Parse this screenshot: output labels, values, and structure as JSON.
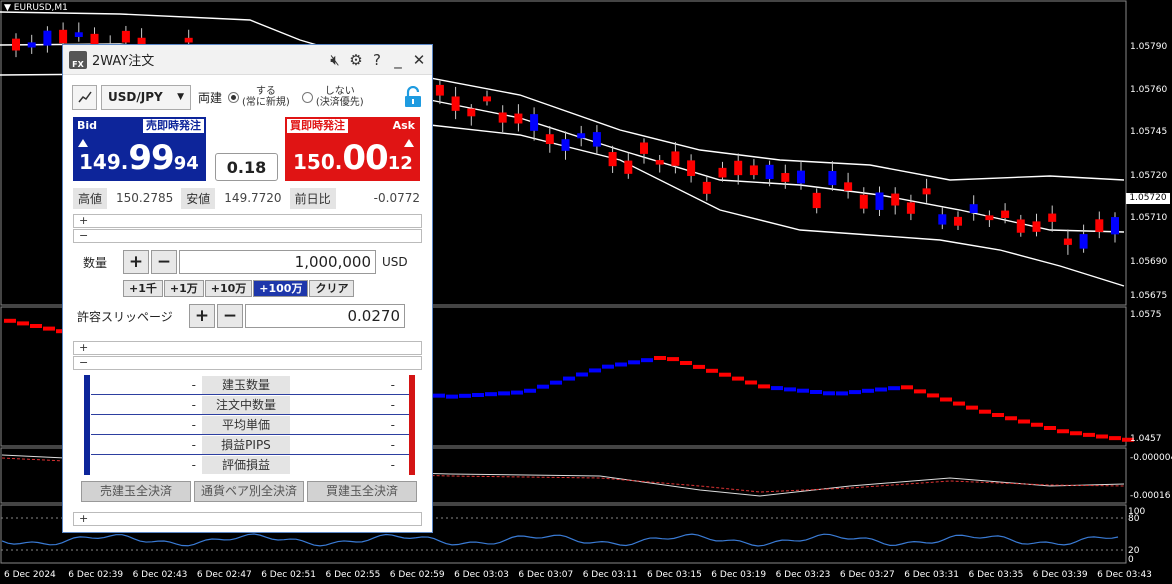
{
  "chart": {
    "symbol": "EURUSD,M1",
    "current_price_tag": "1.05720",
    "main_price_labels": [
      "1.05790",
      "1.05760",
      "1.05745",
      "1.05720",
      "1.05710",
      "1.05690",
      "1.05675"
    ],
    "osc1_labels": [
      "1.0575",
      "1.0457"
    ],
    "osc2_labels": [
      "-0.000004",
      "-0.00016"
    ],
    "osc3_labels": [
      "100",
      "80",
      "20",
      "0"
    ],
    "time_labels": [
      "6 Dec 2024",
      "6 Dec 02:39",
      "6 Dec 02:43",
      "6 Dec 02:47",
      "6 Dec 02:51",
      "6 Dec 02:55",
      "6 Dec 02:59",
      "6 Dec 03:03",
      "6 Dec 03:07",
      "6 Dec 03:11",
      "6 Dec 03:15",
      "6 Dec 03:19",
      "6 Dec 03:23",
      "6 Dec 03:27",
      "6 Dec 03:31",
      "6 Dec 03:35",
      "6 Dec 03:39",
      "6 Dec 03:43"
    ],
    "colors": {
      "bull": "#0000ff",
      "bear": "#ff0000",
      "band": "#ffffff",
      "oscillator": "#3a7bd5"
    }
  },
  "dialog": {
    "title": "2WAY注文",
    "icons": [
      "fx-logo-icon",
      "sound-mute-icon",
      "gear-icon",
      "help-icon",
      "minimize-icon",
      "close-icon"
    ],
    "pair": "USD/JPY",
    "mode_label": "両建",
    "radio_yes_line1": "する",
    "radio_yes_line2": "(常に新規)",
    "radio_no_line1": "しない",
    "radio_no_line2": "(決済優先)",
    "bid_label": "Bid",
    "bid_button": "売即時発注",
    "bid_a": "149.",
    "bid_b": "99",
    "bid_c": "94",
    "ask_label": "Ask",
    "ask_button": "買即時発注",
    "ask_a": "150.",
    "ask_b": "00",
    "ask_c": "12",
    "spread": "0.18",
    "high_label": "高値",
    "high_value": "150.2785",
    "low_label": "安値",
    "low_value": "149.7720",
    "change_label": "前日比",
    "change_value": "-0.0772",
    "expand_plus": "+",
    "expand_minus": "−",
    "qty_label": "数量",
    "qty_value": "1,000,000",
    "qty_unit": "USD",
    "quick": [
      "+1千",
      "+1万",
      "+10万",
      "+100万",
      "クリア"
    ],
    "slip_label": "許容スリッページ",
    "slip_value": "0.0270",
    "plus": "+",
    "minus": "−",
    "positions": [
      {
        "label": "建玉数量",
        "sell": "-",
        "buy": "-"
      },
      {
        "label": "注文中数量",
        "sell": "-",
        "buy": "-"
      },
      {
        "label": "平均単価",
        "sell": "-",
        "buy": "-"
      },
      {
        "label": "損益PIPS",
        "sell": "-",
        "buy": "-"
      },
      {
        "label": "評価損益",
        "sell": "-",
        "buy": "-"
      }
    ],
    "close_sell": "売建玉全決済",
    "close_pair": "通貨ペア別全決済",
    "close_buy": "買建玉全決済"
  }
}
